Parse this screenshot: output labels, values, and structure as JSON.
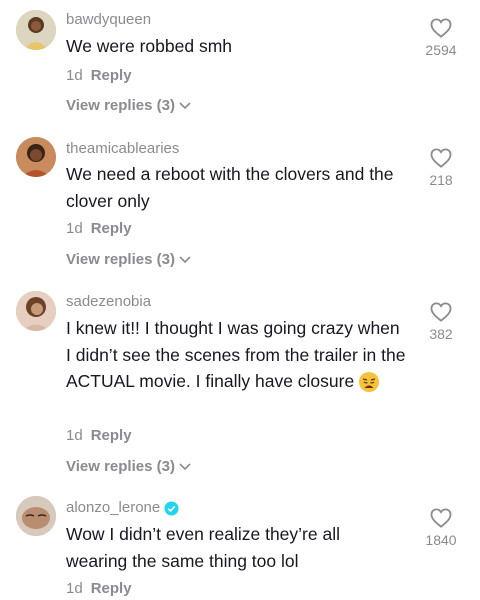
{
  "comments": [
    {
      "username": "bawdyqueen",
      "text": "We were robbed smh",
      "age": "1d",
      "reply_label": "Reply",
      "view_replies": "View replies (3)",
      "likes": "2594",
      "verified": false
    },
    {
      "username": "theamicablearies",
      "text": "We need a reboot with the clovers and the clover only",
      "age": "1d",
      "reply_label": "Reply",
      "view_replies": "View replies (3)",
      "likes": "218",
      "verified": false
    },
    {
      "username": "sadezenobia",
      "text": "I knew it!! I thought I was going crazy when I didn’t see the scenes from the trailer in the ACTUAL movie. I finally have closure",
      "emoji": "weary-face-emoji",
      "age": "1d",
      "reply_label": "Reply",
      "view_replies": "View replies (3)",
      "likes": "382",
      "verified": false
    },
    {
      "username": "alonzo_lerone",
      "text": "Wow I didn’t even realize they’re all wearing the same thing too lol",
      "age": "1d",
      "reply_label": "Reply",
      "likes": "1840",
      "verified": true
    }
  ],
  "colors": {
    "text": "#161823",
    "muted": "#8a8b91",
    "verified": "#20d5ec"
  }
}
